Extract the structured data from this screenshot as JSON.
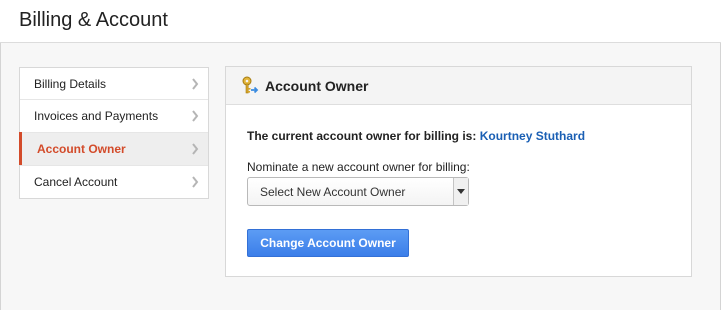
{
  "header": {
    "title": "Billing & Account"
  },
  "sidebar": {
    "items": [
      {
        "label": "Billing Details",
        "active": false
      },
      {
        "label": "Invoices and Payments",
        "active": false
      },
      {
        "label": "Account Owner",
        "active": true
      },
      {
        "label": "Cancel Account",
        "active": false
      }
    ]
  },
  "panel": {
    "title": "Account Owner",
    "current_owner_label": "The current account owner for billing is:",
    "current_owner_name": "Kourtney Stuthard",
    "nominate_label": "Nominate a new account owner for billing:",
    "select_value": "Select New Account Owner",
    "button_label": "Change Account Owner"
  },
  "colors": {
    "accent_active": "#d34b2a",
    "link": "#1a5fb4",
    "button": "#4a8af0"
  }
}
